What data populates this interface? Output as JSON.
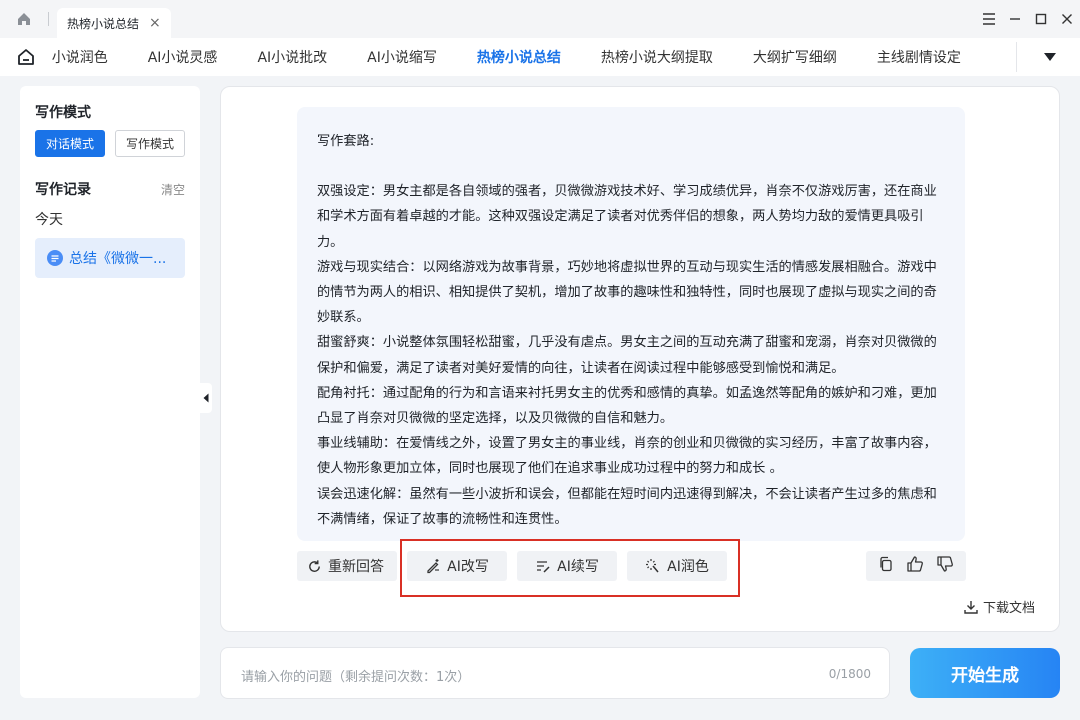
{
  "titlebar": {
    "tab_title": "热榜小说总结",
    "tab_close": "×"
  },
  "nav": {
    "items": [
      "AI小说润色",
      "AI小说灵感",
      "AI小说批改",
      "AI小说缩写",
      "热榜小说总结",
      "热榜小说大纲提取",
      "大纲扩写细纲",
      "主线剧情设定"
    ],
    "active_index": 4
  },
  "sidebar": {
    "mode_title": "写作模式",
    "mode_dialog": "对话模式",
    "mode_write": "写作模式",
    "record_title": "写作记录",
    "clear": "清空",
    "today": "今天",
    "record_item": "总结《微微一..."
  },
  "message": {
    "heading": "写作套路:",
    "paragraphs": [
      "双强设定：男女主都是各自领域的强者，贝微微游戏技术好、学习成绩优异，肖奈不仅游戏厉害，还在商业和学术方面有着卓越的才能。这种双强设定满足了读者对优秀伴侣的想象，两人势均力敌的爱情更具吸引力。",
      "游戏与现实结合：以网络游戏为故事背景，巧妙地将虚拟世界的互动与现实生活的情感发展相融合。游戏中的情节为两人的相识、相知提供了契机，增加了故事的趣味性和独特性，同时也展现了虚拟与现实之间的奇妙联系。",
      "甜蜜舒爽：小说整体氛围轻松甜蜜，几乎没有虐点。男女主之间的互动充满了甜蜜和宠溺，肖奈对贝微微的保护和偏爱，满足了读者对美好爱情的向往，让读者在阅读过程中能够感受到愉悦和满足。",
      "配角衬托：通过配角的行为和言语来衬托男女主的优秀和感情的真挚。如孟逸然等配角的嫉妒和刁难，更加凸显了肖奈对贝微微的坚定选择，以及贝微微的自信和魅力。",
      "事业线辅助：在爱情线之外，设置了男女主的事业线，肖奈的创业和贝微微的实习经历，丰富了故事内容，使人物形象更加立体，同时也展现了他们在追求事业成功过程中的努力和成长 。",
      "误会迅速化解：虽然有一些小波折和误会，但都能在短时间内迅速得到解决，不会让读者产生过多的焦虑和不满情绪，保证了故事的流畅性和连贯性。"
    ]
  },
  "actions": {
    "regenerate": "重新回答",
    "rewrite": "AI改写",
    "continue": "AI续写",
    "polish": "AI润色",
    "download": "下载文档"
  },
  "input": {
    "placeholder": "请输入你的问题（剩余提问次数：1次）",
    "count": "0/1800",
    "generate": "开始生成"
  },
  "colors": {
    "accent": "#1a73e8",
    "highlight": "#d93025"
  }
}
